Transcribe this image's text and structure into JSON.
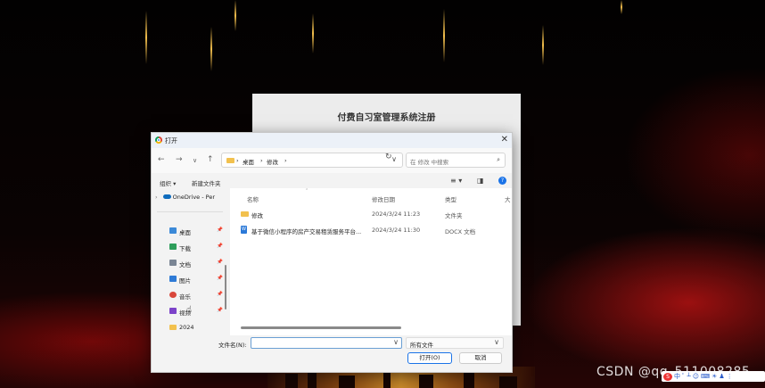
{
  "register": {
    "title": "付费自习室管理系统注册"
  },
  "watermark": "CSDN @qq_511008285",
  "tray": {
    "logo": "S",
    "items": [
      "中",
      "ﾟ",
      "┴",
      "☺",
      "⌨",
      "☀",
      "♟",
      "⋮"
    ]
  },
  "dialog": {
    "title": "打开",
    "close_icon": "✕",
    "nav": {
      "back": "←",
      "forward": "→",
      "recent": "∨",
      "up": "↑",
      "refresh": "↻",
      "addr_chevron": "∨"
    },
    "breadcrumb": [
      "›",
      "桌面",
      "›",
      "修改",
      "›"
    ],
    "search_placeholder": "在 修改 中搜索",
    "search_icon": "⌕",
    "toolbar": {
      "organize": "组织 ▾",
      "new_folder": "新建文件夹",
      "view": "≡ ▾",
      "pane": "◨",
      "help": "?"
    },
    "sidebar": {
      "onedrive": "OneDrive - Per",
      "expand": "›",
      "items": [
        {
          "label": "桌面",
          "icon_color": "#3c8ad8",
          "pin": "📌"
        },
        {
          "label": "下载",
          "icon_color": "#2e9e5b",
          "pin": "📌"
        },
        {
          "label": "文档",
          "icon_color": "#7a8594",
          "pin": "📌"
        },
        {
          "label": "图片",
          "icon_color": "#2f7bd6",
          "pin": "📌"
        },
        {
          "label": "音乐",
          "icon_color": "#d9473b",
          "pin": "📌"
        },
        {
          "label": "视频",
          "icon_color": "#7c43c9",
          "pin": "📌"
        },
        {
          "label": "2024",
          "icon_color": "#f2c14e",
          "pin": ""
        }
      ]
    },
    "columns": {
      "name": "名称",
      "date": "修改日期",
      "type": "类型",
      "size": "大"
    },
    "files": [
      {
        "name": "修改",
        "date": "2024/3/24 11:23",
        "type": "文件夹",
        "kind": "folder"
      },
      {
        "name": "基于微信小程序的房产交易租赁服务平台...",
        "date": "2024/3/24 11:30",
        "type": "DOCX 文档",
        "kind": "doc",
        "glyph": "W"
      }
    ],
    "filename_label": "文件名(N):",
    "filename_value": "",
    "filter_value": "所有文件",
    "open_button": "打开(O)",
    "cancel_button": "取消"
  },
  "colors": {
    "accent": "#1a73e8",
    "folder": "#f2c14e",
    "backdrop_red": "#c81414"
  }
}
